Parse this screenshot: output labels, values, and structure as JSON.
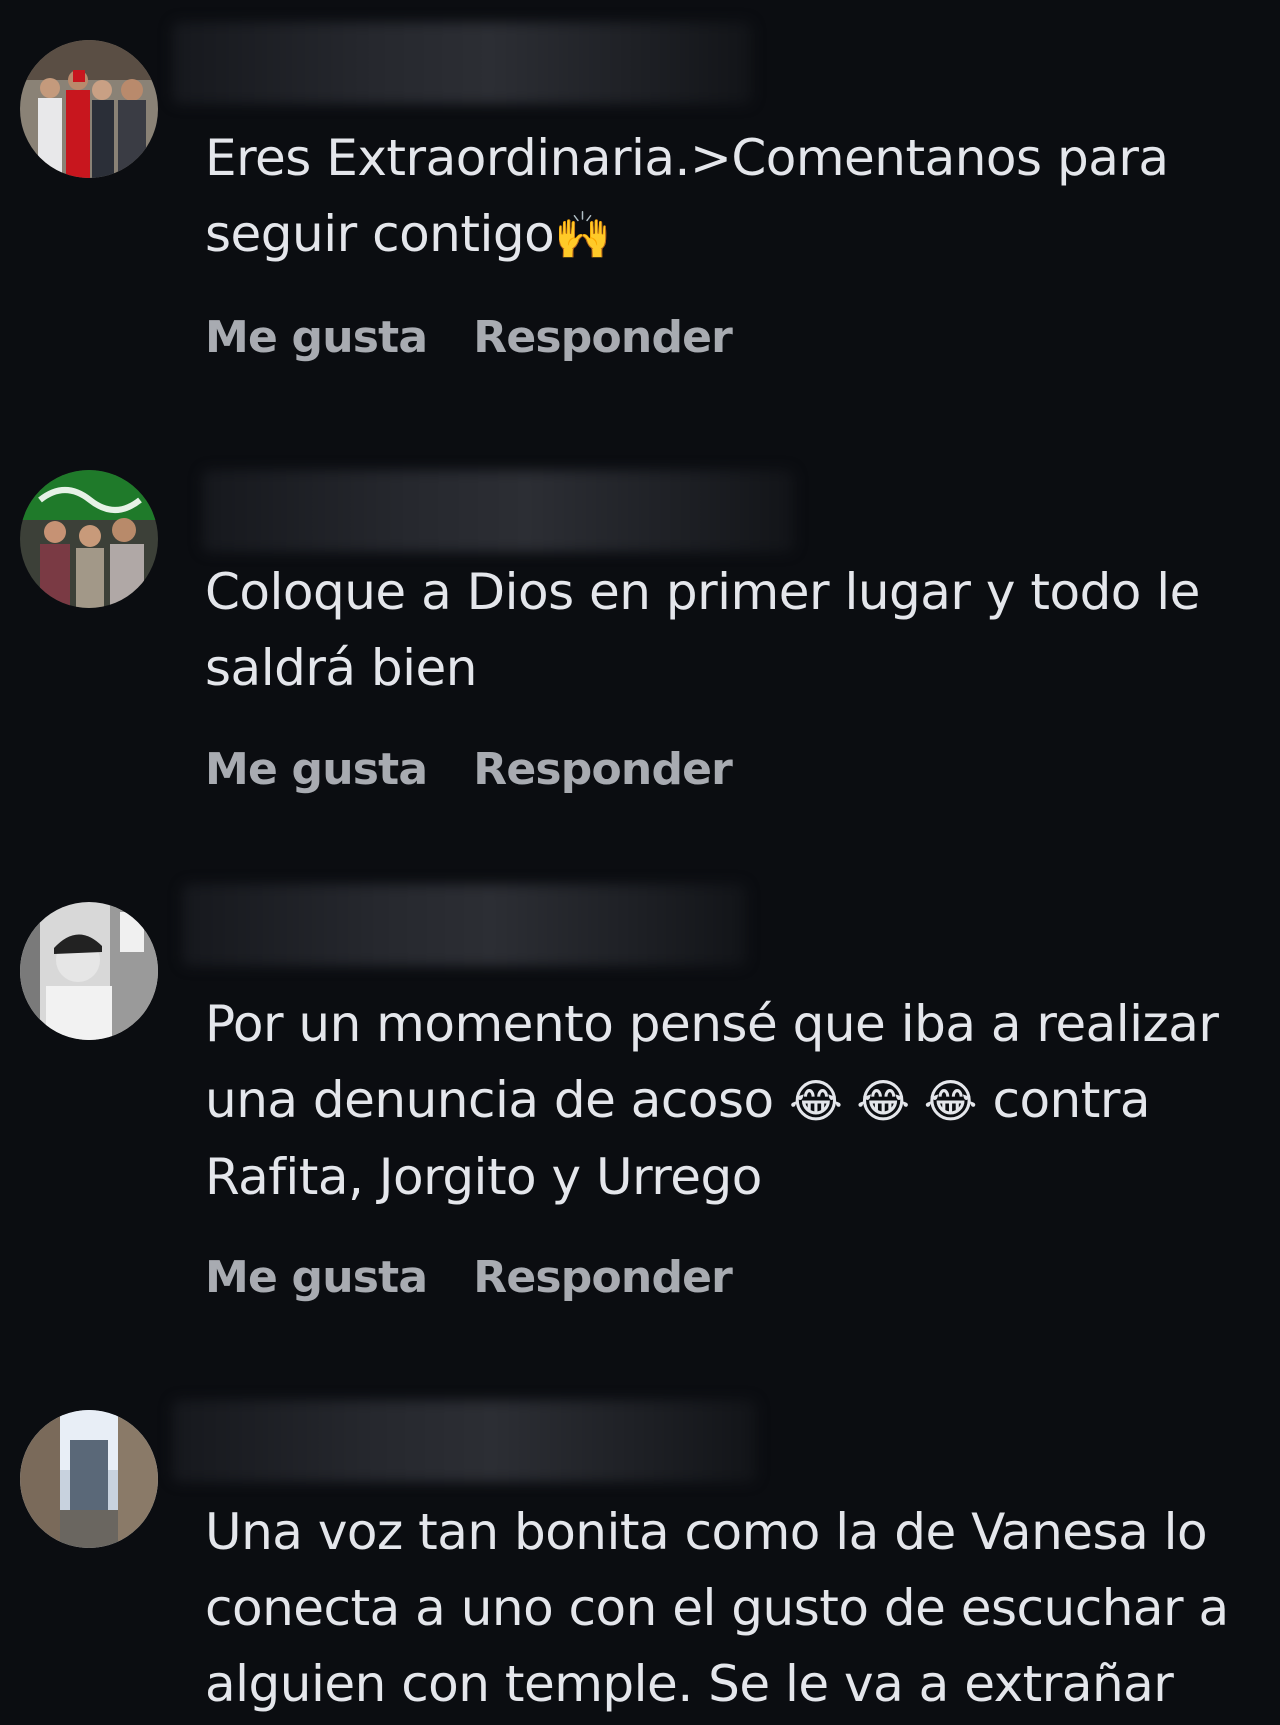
{
  "comments": [
    {
      "text_lines": [
        "Eres Extraordinaria.>Comentanos para",
        "seguir contigo"
      ],
      "emoji": "🙌",
      "like_label": "Me gusta",
      "reply_label": "Responder",
      "avatar_icon": "group-photo-avatar"
    },
    {
      "text_lines": [
        "Coloque a Dios en primer lugar y todo le",
        "saldrá bien"
      ],
      "like_label": "Me gusta",
      "reply_label": "Responder",
      "avatar_icon": "family-photo-avatar"
    },
    {
      "text_lines": [
        "Por un momento pensé que iba a realizar",
        "una denuncia de acoso",
        "contra",
        "Rafita, Jorgito y Urrego"
      ],
      "emoji": "😂 😂 😂",
      "like_label": "Me gusta",
      "reply_label": "Responder",
      "avatar_icon": "grayscale-portrait-avatar"
    },
    {
      "text_lines": [
        "Una voz tan bonita como la de Vanesa lo",
        "conecta a uno con el gusto de escuchar a",
        "alguien con temple. Se le va a extrañar"
      ],
      "avatar_icon": "street-photo-avatar"
    }
  ],
  "colors": {
    "background": "#0b0d11",
    "text": "#e4e6eb",
    "action": "#a8abb1"
  }
}
